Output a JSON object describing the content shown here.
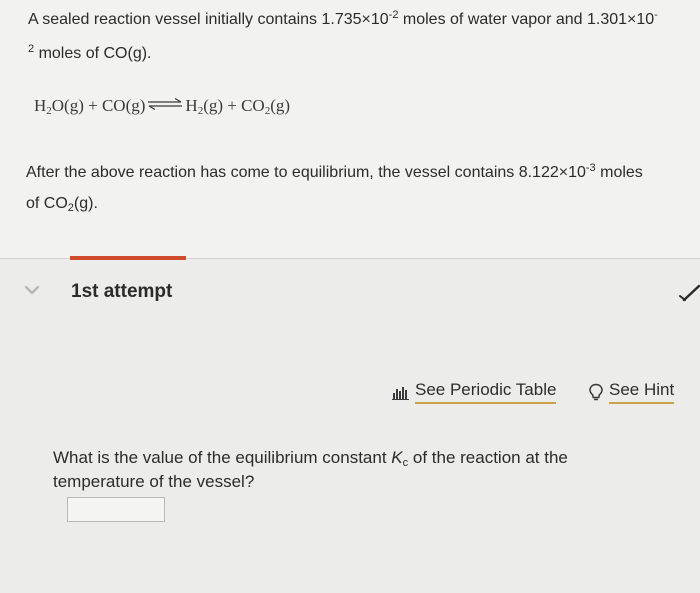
{
  "question": {
    "intro": {
      "text_before_exp1": "A sealed reaction vessel initially contains 1.735×10",
      "exp1": "-2",
      "text_mid": " moles of water vapor and 1.301×10",
      "exp2_dash": "-",
      "line2_exp": "2",
      "line2_text": " moles of CO(g)."
    },
    "equation": {
      "reactant1": "H",
      "reactant1_sub": "2",
      "reactant1_rest": "O(g) + CO(g)",
      "product1": "H",
      "product1_sub": "2",
      "product1_rest": "(g) + CO",
      "product2_sub": "2",
      "product2_rest": "(g)"
    },
    "equilibrium": {
      "text_before": "After the above reaction has come to equilibrium, the vessel contains 8.122×10",
      "exp": "-3",
      "text_after": " moles",
      "line2_a": "of CO",
      "line2_sub": "2",
      "line2_b": "(g)."
    }
  },
  "attempt": {
    "label": "1st attempt",
    "accent_color": "#d04a2c"
  },
  "links": {
    "periodic_table": "See Periodic Table",
    "periodic_icon": "chart-icon",
    "hint": "See Hint",
    "hint_icon": "lightbulb-icon",
    "underline_color": "#c9a24a"
  },
  "prompt": {
    "text_before": "What is the value of the equilibrium constant ",
    "k": "K",
    "k_sub": "c",
    "text_after": " of the reaction at the",
    "line2": "temperature of the vessel?"
  },
  "answer": {
    "value": "",
    "placeholder": ""
  }
}
